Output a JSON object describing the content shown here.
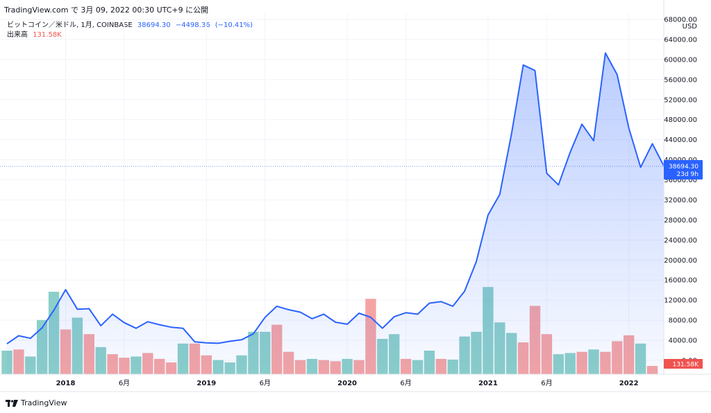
{
  "header": {
    "text": "TradingView.com で 3月 09, 2022 00:30 UTC+9 に公開"
  },
  "legend": {
    "symbol": "ビットコイン／米ドル, 1月, COINBASE",
    "price": "38694.30",
    "change": "−4498.36",
    "change_pct": "(−10.41%)",
    "volume_label": "出来高",
    "volume_value": "131.58K"
  },
  "price_badge": {
    "price": "38694.30",
    "countdown": "23d 9h"
  },
  "volume_badge": {
    "value": "131.58K"
  },
  "footer": {
    "brand": "TradingView"
  },
  "colors": {
    "line": "#2962ff",
    "fill": "#2962ff",
    "vol_up": "#8ccfc9",
    "vol_down": "#f5a4a4",
    "badge_price": "#2962ff",
    "badge_vol": "#ef5350"
  },
  "chart_data": {
    "type": "line",
    "currency": "USD",
    "y_ticks": [
      "68000.00",
      "64000.00",
      "60000.00",
      "56000.00",
      "52000.00",
      "48000.00",
      "44000.00",
      "40000.00",
      "36000.00",
      "32000.00",
      "28000.00",
      "24000.00",
      "20000.00",
      "16000.00",
      "12000.00",
      "8000.00",
      "4000.00",
      "0.00"
    ],
    "ylim": [
      0,
      68000
    ],
    "x_ticks": [
      {
        "label": "2018",
        "index": 5,
        "bold": true
      },
      {
        "label": "6月",
        "index": 10,
        "bold": false
      },
      {
        "label": "2019",
        "index": 17,
        "bold": true
      },
      {
        "label": "6月",
        "index": 22,
        "bold": false
      },
      {
        "label": "2020",
        "index": 29,
        "bold": true
      },
      {
        "label": "6月",
        "index": 34,
        "bold": false
      },
      {
        "label": "2021",
        "index": 41,
        "bold": true
      },
      {
        "label": "6月",
        "index": 46,
        "bold": false
      },
      {
        "label": "2022",
        "index": 53,
        "bold": true
      }
    ],
    "price": [
      3300,
      4900,
      4400,
      6500,
      10000,
      14100,
      10200,
      10300,
      6900,
      9200,
      7500,
      6400,
      7700,
      7100,
      6600,
      6400,
      3700,
      3500,
      3400,
      3800,
      4100,
      5300,
      8600,
      10800,
      10100,
      9600,
      8300,
      9200,
      7600,
      7200,
      9400,
      8600,
      6400,
      8700,
      9500,
      9200,
      11400,
      11700,
      10800,
      13800,
      19700,
      29000,
      33100,
      45200,
      58900,
      57800,
      37300,
      35000,
      41500,
      47100,
      43800,
      61300,
      57000,
      46300,
      38500,
      43200,
      38694
    ],
    "volume": [
      {
        "v": 1.0,
        "up": true
      },
      {
        "v": 1.05,
        "up": false
      },
      {
        "v": 0.75,
        "up": true
      },
      {
        "v": 2.3,
        "up": true
      },
      {
        "v": 3.5,
        "up": true
      },
      {
        "v": 1.9,
        "up": false
      },
      {
        "v": 2.4,
        "up": true
      },
      {
        "v": 1.7,
        "up": false
      },
      {
        "v": 1.15,
        "up": true
      },
      {
        "v": 0.85,
        "up": false
      },
      {
        "v": 0.7,
        "up": false
      },
      {
        "v": 0.75,
        "up": true
      },
      {
        "v": 0.9,
        "up": false
      },
      {
        "v": 0.65,
        "up": false
      },
      {
        "v": 0.5,
        "up": false
      },
      {
        "v": 1.3,
        "up": true
      },
      {
        "v": 1.3,
        "up": false
      },
      {
        "v": 0.8,
        "up": false
      },
      {
        "v": 0.6,
        "up": true
      },
      {
        "v": 0.5,
        "up": true
      },
      {
        "v": 0.8,
        "up": true
      },
      {
        "v": 1.8,
        "up": true
      },
      {
        "v": 1.8,
        "up": true
      },
      {
        "v": 2.1,
        "up": false
      },
      {
        "v": 0.95,
        "up": false
      },
      {
        "v": 0.6,
        "up": false
      },
      {
        "v": 0.65,
        "up": true
      },
      {
        "v": 0.6,
        "up": false
      },
      {
        "v": 0.55,
        "up": false
      },
      {
        "v": 0.65,
        "up": true
      },
      {
        "v": 0.6,
        "up": false
      },
      {
        "v": 3.2,
        "up": false
      },
      {
        "v": 1.5,
        "up": true
      },
      {
        "v": 1.7,
        "up": true
      },
      {
        "v": 0.65,
        "up": false
      },
      {
        "v": 0.6,
        "up": true
      },
      {
        "v": 1.0,
        "up": true
      },
      {
        "v": 0.65,
        "up": false
      },
      {
        "v": 0.62,
        "up": true
      },
      {
        "v": 1.6,
        "up": true
      },
      {
        "v": 1.8,
        "up": true
      },
      {
        "v": 3.7,
        "up": true
      },
      {
        "v": 2.2,
        "up": true
      },
      {
        "v": 1.75,
        "up": true
      },
      {
        "v": 1.35,
        "up": false
      },
      {
        "v": 2.9,
        "up": false
      },
      {
        "v": 1.7,
        "up": false
      },
      {
        "v": 0.85,
        "up": true
      },
      {
        "v": 0.9,
        "up": true
      },
      {
        "v": 0.95,
        "up": false
      },
      {
        "v": 1.05,
        "up": true
      },
      {
        "v": 0.95,
        "up": false
      },
      {
        "v": 1.4,
        "up": false
      },
      {
        "v": 1.65,
        "up": false
      },
      {
        "v": 1.3,
        "up": true
      },
      {
        "v": 0.35,
        "up": false
      }
    ]
  }
}
